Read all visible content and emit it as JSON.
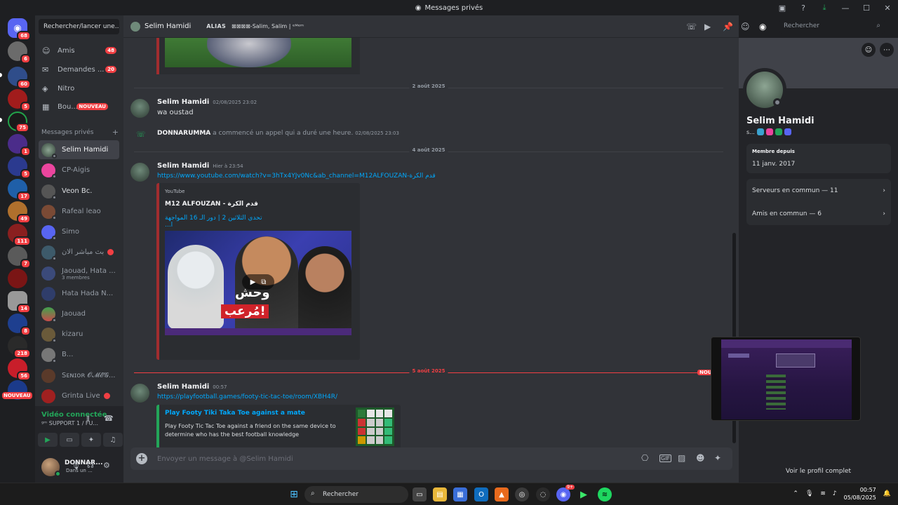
{
  "window": {
    "title": "Messages privés"
  },
  "sidebar": {
    "search_label": "Rechercher/lancer une...",
    "nav": [
      {
        "label": "Amis",
        "badge": "48"
      },
      {
        "label": "Demandes ...",
        "badge": "20"
      },
      {
        "label": "Nitro",
        "badge": ""
      },
      {
        "label": "Bou...",
        "badge": "NOUVEAU"
      }
    ],
    "dm_header": "Messages privés",
    "dm_add": "+",
    "dms": [
      {
        "name": "Selim Hamidi",
        "sub": ""
      },
      {
        "name": "CP-Aigis",
        "sub": ""
      },
      {
        "name": "Veon Bc.",
        "sub": ""
      },
      {
        "name": "Rafeal leao",
        "sub": ""
      },
      {
        "name": "Simo",
        "sub": ""
      },
      {
        "name": "بث مباشر الان",
        "sub": ""
      },
      {
        "name": "Jaouad, Hata ...",
        "sub": "3 membres"
      },
      {
        "name": "Hata Hada N...",
        "sub": ""
      },
      {
        "name": "Jaouad",
        "sub": ""
      },
      {
        "name": "kizaru",
        "sub": ""
      },
      {
        "name": "B...",
        "sub": ""
      },
      {
        "name": "Ѕᴇɴɪᴏʀ 𝓞𝓜𝓔𝓖...",
        "sub": ""
      },
      {
        "name": "Grinta Live",
        "sub": ""
      }
    ]
  },
  "servers": {
    "badges": [
      "68",
      "6",
      "60",
      "5",
      "75",
      "1",
      "5",
      "17",
      "49",
      "111",
      "7",
      "14",
      "8",
      "218",
      "56",
      "NOUVEAU"
    ]
  },
  "voice": {
    "status": "Vidéo connectée",
    "channel": "ᵍᵐ SUPPORT 1 / FU..."
  },
  "user": {
    "name": "DONNAR...",
    "status": "Dans un ..."
  },
  "chat_header": {
    "name": "Selim Hamidi",
    "alias_label": "ALIAS",
    "alias_value": "⊠⊠⊠⊠-Salim, Salim | ᵉᴹᵉᵐ",
    "search_placeholder": "Rechercher"
  },
  "messages": {
    "date1": "2 août 2025",
    "m1": {
      "author": "Selim Hamidi",
      "time": "02/08/2025 23:02",
      "text": "wa oustad"
    },
    "call": {
      "author": "DONNARUMMA",
      "text": " a commencé un appel qui a duré une heure.",
      "time": "02/08/2025 23:03"
    },
    "date2": "4 août 2025",
    "m2": {
      "author": "Selim Hamidi",
      "time": "Hier à 23:54",
      "link": "https://www.youtube.com/watch?v=3hTx4YJv0Nc&ab_channel=M12ALFOUZAN-قدم الكرة",
      "embed_provider": "YouTube",
      "embed_author": "M12 ALFOUZAN - قدم الكرة",
      "embed_title": "تحدي الثلاثين 2 | دور الـ 16 المواجهة ا...",
      "thumb_text1": "وحش",
      "thumb_text2": "مُرعب!"
    },
    "date3": "5 août 2025",
    "new_label": "NOU",
    "m3": {
      "author": "Selim Hamidi",
      "time": "00:57",
      "link": "https://playfootball.games/footy-tic-tac-toe/room/XBH4R/",
      "embed_title": "Play Footy Tiki Taka Toe against a mate",
      "embed_desc": "Play Footy Tic Tac Toe against a friend on the same device to determine who has the best football knowledge"
    }
  },
  "composer": {
    "placeholder": "Envoyer un message à @Selim Hamidi"
  },
  "profile": {
    "name": "Selim Hamidi",
    "tag": "s...",
    "member_since_label": "Membre depuis",
    "member_since": "11 janv. 2017",
    "servers_common": "Serveurs en commun — 11",
    "friends_common": "Amis en commun — 6",
    "view_full": "Voir le profil complet"
  },
  "taskbar": {
    "search": "Rechercher",
    "time": "00:57",
    "date": "05/08/2025",
    "discord_badge": "9+"
  },
  "colors": {
    "accent": "#5865f2",
    "danger": "#f23f43",
    "link": "#00a8fc",
    "online": "#23a559"
  }
}
